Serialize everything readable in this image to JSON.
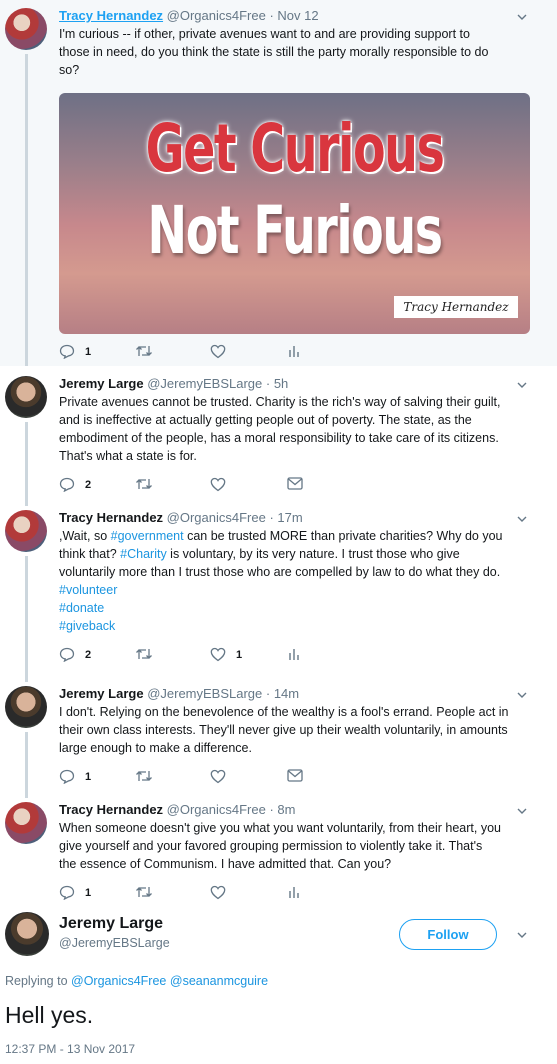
{
  "tweets": [
    {
      "name": "Tracy Hernandez",
      "handle": "@Organics4Free",
      "time": "Nov 12",
      "lines": [
        "I'm curious -- if other, private avenues want to and are providing support to",
        "those in need, do you think the state is still the party morally responsible to do",
        "so?"
      ],
      "media": {
        "line1": "Get Curious",
        "line2": "Not Furious",
        "signature": "Tracy Hernandez"
      },
      "replies": "1",
      "likes": ""
    },
    {
      "name": "Jeremy Large",
      "handle": "@JeremyEBSLarge",
      "time": "5h",
      "lines": [
        "Private avenues cannot be trusted. Charity is the rich's way of salving their guilt,",
        "and is ineffective at actually getting people out of poverty. The state, as the",
        "embodiment of the people, has a moral responsibility to take care of its citizens.",
        "That's what a state is for."
      ],
      "replies": "2",
      "likes": ""
    },
    {
      "name": "Tracy Hernandez",
      "handle": "@Organics4Free",
      "time": "17m",
      "line1a": ",Wait, so ",
      "line1b": "#government",
      "line1c": " can be trusted MORE than private charities?  Why do you",
      "line2a": "think that?  ",
      "line2b": "#Charity",
      "line2c": " is voluntary, by its very nature.  I trust those who give",
      "line3": "voluntarily more than I trust those who are compelled by law to do what they do.",
      "hashtags": [
        "#volunteer",
        "#donate",
        "#giveback"
      ],
      "replies": "2",
      "likes": "1"
    },
    {
      "name": "Jeremy Large",
      "handle": "@JeremyEBSLarge",
      "time": "14m",
      "lines": [
        "I don't. Relying on the benevolence of the wealthy is a fool's errand. People act in",
        "their own class interests. They'll never give up their wealth voluntarily, in amounts",
        "large enough to make a difference."
      ],
      "replies": "1",
      "likes": ""
    },
    {
      "name": "Tracy Hernandez",
      "handle": "@Organics4Free",
      "time": "8m",
      "lines": [
        "When someone doesn't give you what you want voluntarily, from their heart, you",
        "give yourself and your favored grouping permission to violently take it.  That's",
        "the essence of Communism.  I have admitted that.  Can you?"
      ],
      "replies": "1",
      "likes": ""
    }
  ],
  "main": {
    "name": "Jeremy Large",
    "handle": "@JeremyEBSLarge",
    "follow_label": "Follow",
    "replying_prefix": "Replying to ",
    "replying_user1": "@Organics4Free",
    "replying_user2": "@seananmcguire",
    "text": "Hell yes.",
    "timestamp": "12:37 PM - 13 Nov 2017"
  },
  "separator": " · ",
  "icons": [
    "reply-icon",
    "retweet-icon",
    "like-icon",
    "analytics-icon",
    "message-icon",
    "chevron-down-icon"
  ],
  "colors": {
    "link": "#1da1f2",
    "hashtag": "#1b95e0",
    "muted": "#657786",
    "thread_line": "#ccd6dd"
  }
}
